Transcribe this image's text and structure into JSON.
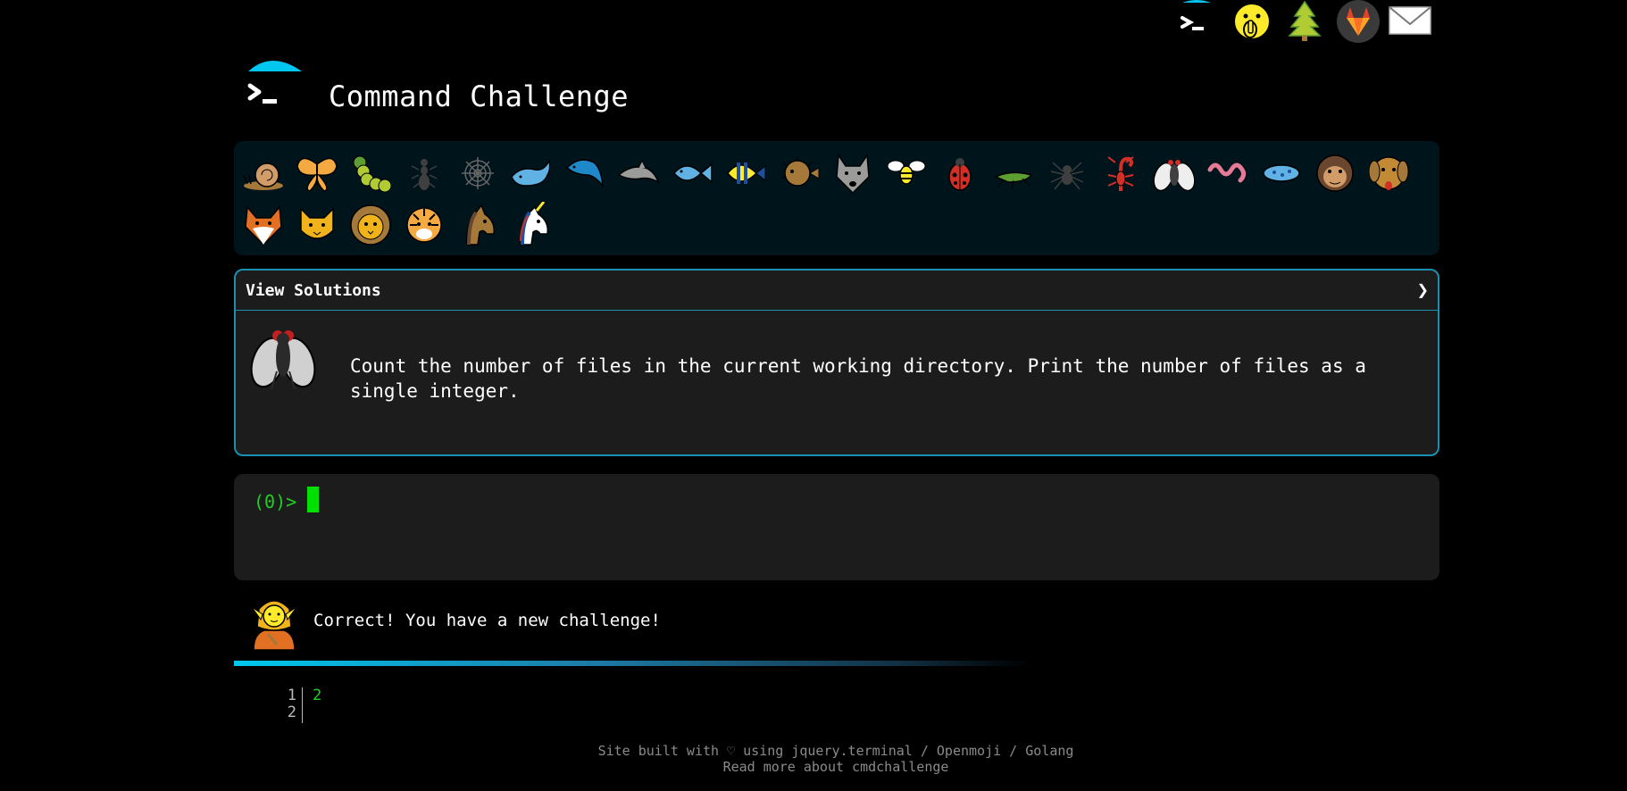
{
  "header": {
    "title": "Command Challenge"
  },
  "top_icons": [
    "terminal-icon",
    "shushing-face-icon",
    "tree-icon",
    "gitlab-icon",
    "mail-icon"
  ],
  "animals": [
    "snail",
    "butterfly",
    "caterpillar",
    "ant",
    "spider-web",
    "whale",
    "dolphin",
    "dolphin-gray",
    "fish",
    "tropical-fish",
    "blowfish",
    "wolf",
    "bee",
    "lady-beetle",
    "cricket",
    "spider",
    "scorpion",
    "fly",
    "worm",
    "microbe",
    "monkey",
    "dog",
    "fox",
    "cat",
    "lion",
    "tiger",
    "horse",
    "unicorn"
  ],
  "solutions": {
    "label": "View Solutions",
    "chevron": "❯",
    "challenge_text": "Count the number of files in the current working directory. Print the number of files as a single integer."
  },
  "terminal": {
    "prompt": "(0)> "
  },
  "result": {
    "message": "Correct! You have a new challenge!"
  },
  "output": {
    "line_numbers": [
      "1",
      "2"
    ],
    "value": "2"
  },
  "footer": {
    "prefix": "Site built with ♡ using ",
    "link_jquery": "jquery.terminal",
    "sep1": " / ",
    "link_openmoji": "Openmoji",
    "sep2": " / ",
    "link_golang": "Golang",
    "read_more": "Read more about cmdchallenge"
  },
  "colors": {
    "accent": "#1a8fb0",
    "terminal_green": "#20d020",
    "panel_bg": "#1c1c1c",
    "animals_bg": "#00141c"
  }
}
